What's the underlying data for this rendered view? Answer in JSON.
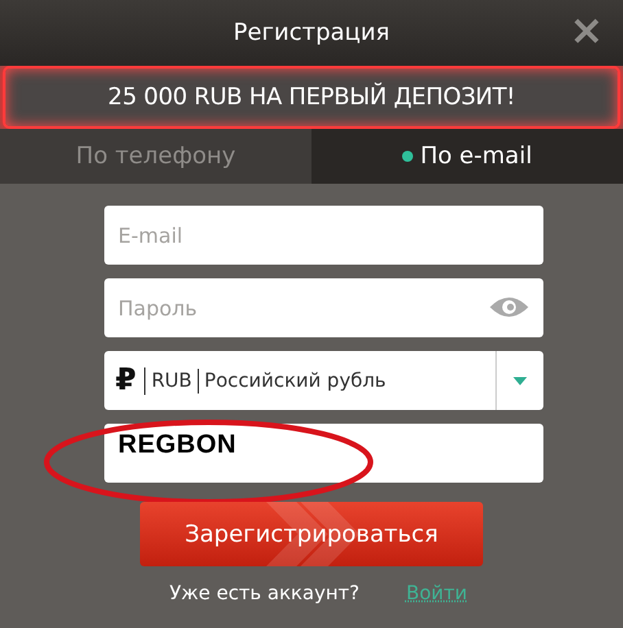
{
  "window": {
    "title": "Регистрация",
    "close": "×"
  },
  "banner": "25 000 RUB НА ПЕРВЫЙ ДЕПОЗИТ!",
  "tabs": [
    {
      "label": "По телефону",
      "selected": false
    },
    {
      "label": "По e-mail",
      "selected": true
    }
  ],
  "fields": [
    {
      "kind": "text",
      "placeholder": "E-mail"
    },
    {
      "kind": "password",
      "placeholder": "Пароль"
    },
    {
      "kind": "currency",
      "symbol": "₽",
      "code": "RUB",
      "name": "Российский рубль"
    },
    {
      "kind": "promo",
      "value": "REGBON",
      "highlighted": true
    }
  ],
  "submit": "Зарегистрироваться",
  "footer": {
    "text": "Уже есть аккаунт?",
    "link": "Войти"
  }
}
